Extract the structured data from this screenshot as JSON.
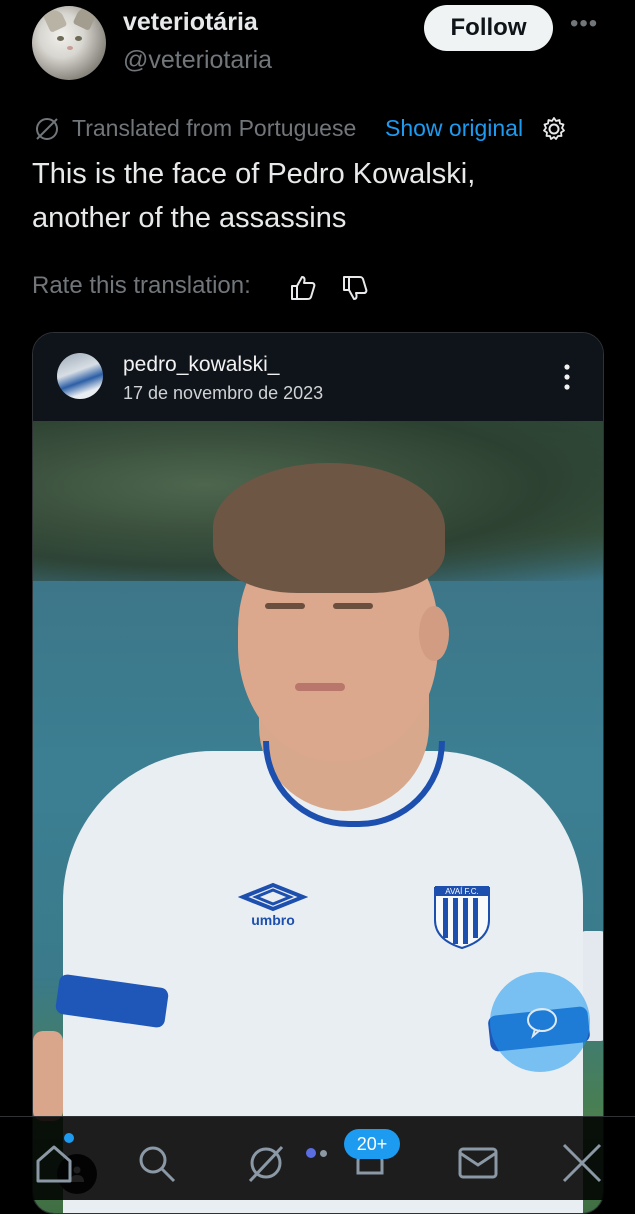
{
  "post": {
    "display_name": "veteriotária",
    "handle": "@veteriotaria",
    "follow_label": "Follow",
    "more_label": "•••",
    "translation": {
      "translated_from": "Translated from Portuguese",
      "show_original": "Show original"
    },
    "text": "This is the face of Pedro Kowalski,\nanother of the assassins",
    "rate_label": "Rate this translation:"
  },
  "embed": {
    "username": "pedro_kowalski_",
    "date": "17 de novembro de 2023",
    "shirt_brand": "umbro",
    "crest_text": "AVAÍ F.C."
  },
  "nav": {
    "notifications_badge": "20+"
  },
  "colors": {
    "accent": "#1d9bf0",
    "background": "#000000",
    "muted": "#71767b"
  }
}
